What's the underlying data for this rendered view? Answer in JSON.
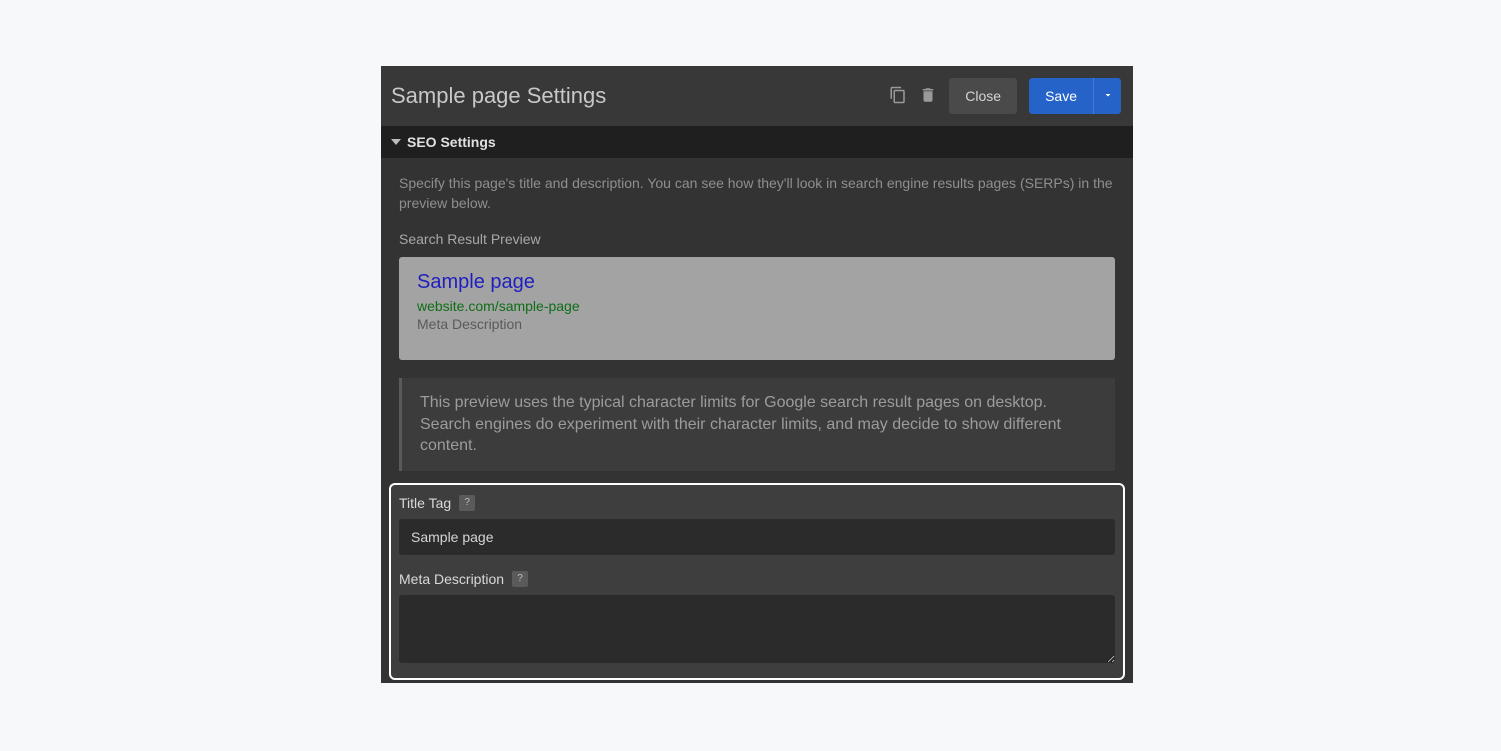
{
  "header": {
    "title": "Sample page Settings",
    "close_label": "Close",
    "save_label": "Save"
  },
  "section": {
    "title": "SEO Settings",
    "description": "Specify this page's title and description. You can see how they'll look in search engine results pages (SERPs) in the preview below.",
    "preview_label": "Search Result Preview",
    "serp": {
      "title": "Sample page",
      "url": "website.com/sample-page",
      "meta": "Meta Description"
    },
    "info": "This preview uses the typical character limits for Google search result pages on desktop. Search engines do experiment with their character limits, and may decide to show different content.",
    "fields": {
      "title_tag_label": "Title Tag",
      "title_tag_value": "Sample page",
      "meta_desc_label": "Meta Description",
      "meta_desc_value": ""
    },
    "help_glyph": "?"
  }
}
